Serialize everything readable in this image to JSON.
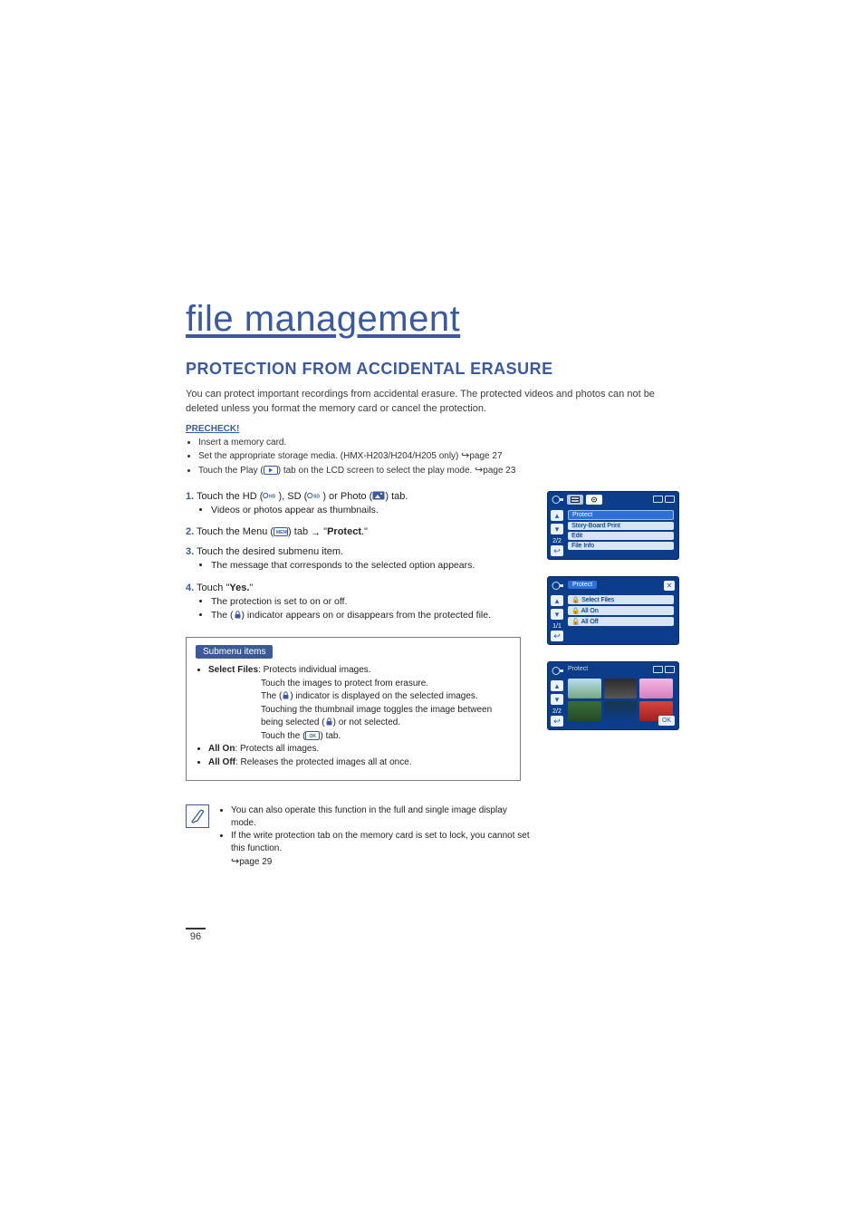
{
  "title": "file management",
  "section_heading": "PROTECTION FROM ACCIDENTAL ERASURE",
  "intro": "You can protect important recordings from accidental erasure. The protected videos and photos can not be deleted unless you format the memory card or cancel the protection.",
  "precheck_label": "PRECHECK!",
  "precheck": {
    "item1": "Insert a memory card.",
    "item2_a": "Set the appropriate storage media. (HMX-H203/H204/H205 only) ",
    "item2_b": "page 27",
    "item3_a": "Touch the Play (",
    "item3_b": ") tab on the LCD screen to select the play mode. ",
    "item3_c": "page 23"
  },
  "steps": {
    "s1_num": "1.",
    "s1_a": "Touch the HD (",
    "s1_b": " ), SD (",
    "s1_c": " ) or Photo (",
    "s1_d": ") tab.",
    "s1_sub": "Videos or photos appear as thumbnails.",
    "s2_num": "2.",
    "s2_a": "Touch the Menu (",
    "s2_b": ") tab ",
    "s2_c": " \"",
    "s2_d": "Protect",
    "s2_e": ".\"",
    "s3_num": "3.",
    "s3_a": "Touch the desired submenu item.",
    "s3_sub": "The message that corresponds to the selected option appears.",
    "s4_num": "4.",
    "s4_a": "Touch \"",
    "s4_b": "Yes.",
    "s4_c": "\"",
    "s4_sub1": "The protection is set to on or off.",
    "s4_sub2_a": "The (",
    "s4_sub2_b": ") indicator appears on or disappears from the protected file."
  },
  "submenu": {
    "label": "Submenu items",
    "sf_bold": "Select Files",
    "sf_rest": ": Protects individual images.",
    "sf_l1": "Touch the images to protect from erasure.",
    "sf_l2_a": "The (",
    "sf_l2_b": ") indicator is displayed on the selected images.",
    "sf_l3_a": "Touching the thumbnail image toggles the image between being selected (",
    "sf_l3_b": ") or not selected.",
    "sf_l4_a": "Touch the (",
    "sf_l4_b": ") tab.",
    "sf_l4_ok": "OK",
    "ao_bold": "All On",
    "ao_rest": ": Protects all images.",
    "aoff_bold": "All Off",
    "aoff_rest": ": Releases the protected images all at once."
  },
  "notes": {
    "n1": "You can also operate this function in the full and single image display mode.",
    "n2_a": "If the write protection tab on the memory card is set to lock, you cannot set this function. ",
    "n2_b": "page 29"
  },
  "page_number": "96",
  "lcd1": {
    "highlight": "Protect",
    "m1": "Story-Board Print",
    "m2": "Edit",
    "m3": "File Info",
    "page": "2/2"
  },
  "lcd2": {
    "title": "Protect",
    "m1": "Select Files",
    "m2": "All On",
    "m3": "All Off",
    "page": "1/1"
  },
  "lcd3": {
    "title": "Protect",
    "page": "2/2",
    "ok": "OK"
  }
}
